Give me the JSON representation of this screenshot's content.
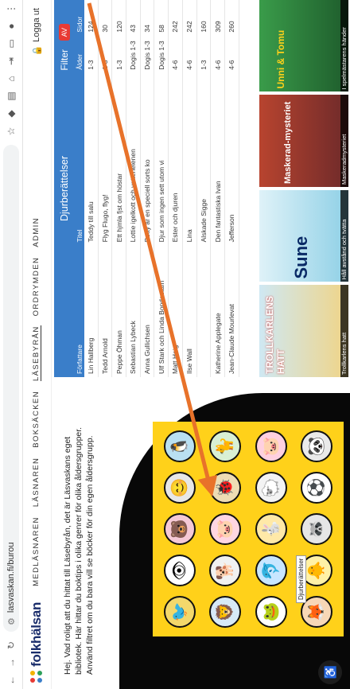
{
  "browser": {
    "url": "lasvaskan.fi/burou"
  },
  "site": {
    "logo": "folkhälsan",
    "nav": [
      "MEDLÄSNAREN",
      "LÄSNAREN",
      "BOKSÄCKEN",
      "LÄSEBYRÅN",
      "ORDRYMDEN",
      "ADMIN"
    ],
    "logout": "Logga ut"
  },
  "intro": "Hej. Vad roligt att du hittat till Läsebyrån, det är Läsvaskans eget bibliotek. Här hittar du boktips i olika genrer för olika åldersgrupper. Använd filtret om du bara vill se böcker för din egen åldersgrupp.",
  "grid": {
    "tooltip": "Djurberättelser",
    "icons": [
      "🐦",
      "👁",
      "🐻",
      "😊",
      "🐧",
      "🦁",
      "🐕",
      "🐷",
      "🐞",
      "🐈",
      "🐸",
      "🐬",
      "🐇",
      "🐑",
      "🐷",
      "🦊",
      "🐥",
      "🦝",
      "⚽",
      "🐼"
    ]
  },
  "table": {
    "title": "Djurberättelser",
    "filter": "Filter",
    "badge": "AV",
    "headers": [
      "Författare",
      "Titel",
      "Ålder",
      "Sidor"
    ],
    "rows": [
      [
        "Lin Hallberg",
        "Teddy till salu",
        "1-3",
        "124"
      ],
      [
        "Tedd Arnold",
        "Flyg Flugo, flyg!",
        "1-3",
        "30"
      ],
      [
        "Peppe Öhman",
        "Ett hjmla fjst om höstar",
        "1-3",
        "120"
      ],
      [
        "Sebastian Lybeck",
        "Lottie igelkott och vattenelenen",
        "Dogis 1-3",
        "43"
      ],
      [
        "Anna Gullichsen",
        "Betty är en speciell sorts ko",
        "Dogis 1-3",
        "34"
      ],
      [
        "Ulf Stark och Linda Bondestam",
        "Djur som ingen sett utom vi",
        "Dogis 1-3",
        "58"
      ],
      [
        "Matt Haig",
        "Ester och djuren",
        "4-6",
        "242"
      ],
      [
        "Ilse Wall",
        "Lina",
        "4-6",
        "242"
      ],
      [
        "",
        "Alskade Sigge",
        "1-3",
        "160"
      ],
      [
        "Katherine Applegate",
        "Den fantastiska Ivan",
        "4-6",
        "309"
      ],
      [
        "Jean-Claude Mourlevat",
        "Jefferson",
        "4-6",
        "260"
      ]
    ]
  },
  "covers": [
    {
      "title": "TROLLKARLENS HATT",
      "caption": "Trollkarlens hatt"
    },
    {
      "title": "Sune",
      "caption": "Håll avstånd och tvätta"
    },
    {
      "title": "Maskerad-mysteriet",
      "caption": "Maskeradmysteriet"
    },
    {
      "title": "Unni & Tomu",
      "caption": "I spelmästarens händer"
    }
  ],
  "colors": {
    "accent": "#3a7ec9",
    "yellow": "#ffd11a",
    "arrow": "#e8722a"
  }
}
